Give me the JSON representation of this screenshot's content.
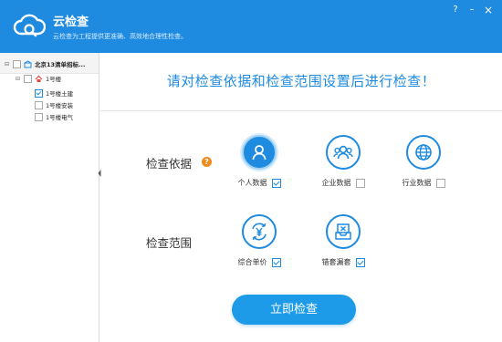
{
  "app": {
    "title": "云检查",
    "subtitle": "云检查为工程提供更准确、高效地合理性检查。"
  },
  "window_controls": {
    "help": "?",
    "minimize": "–",
    "close": "×"
  },
  "sidebar": {
    "tree": {
      "root": {
        "label": "北京13清单招标...",
        "checked": false,
        "expanded": true
      },
      "building": {
        "label": "1号楼",
        "checked": false,
        "expanded": true
      },
      "children": [
        {
          "label": "1号楼土建",
          "checked": true
        },
        {
          "label": "1号楼安装",
          "checked": false
        },
        {
          "label": "1号楼电气",
          "checked": false
        }
      ]
    }
  },
  "main": {
    "title": "请对检查依据和检查范围设置后进行检查！",
    "basis": {
      "label": "检查依据",
      "help": "?",
      "options": [
        {
          "label": "个人数据",
          "checked": true,
          "icon": "person-icon",
          "selected": true
        },
        {
          "label": "企业数据",
          "checked": false,
          "icon": "group-icon",
          "selected": false
        },
        {
          "label": "行业数据",
          "checked": false,
          "icon": "globe-icon",
          "selected": false
        }
      ]
    },
    "scope": {
      "label": "检查范围",
      "options": [
        {
          "label": "综合单价",
          "checked": true,
          "icon": "yuan-cycle-icon"
        },
        {
          "label": "错套漏套",
          "checked": true,
          "icon": "inbox-x-icon"
        }
      ]
    },
    "start_button": "立即检查"
  },
  "colors": {
    "accent": "#1e8be0",
    "help_badge": "#f08a1c"
  }
}
